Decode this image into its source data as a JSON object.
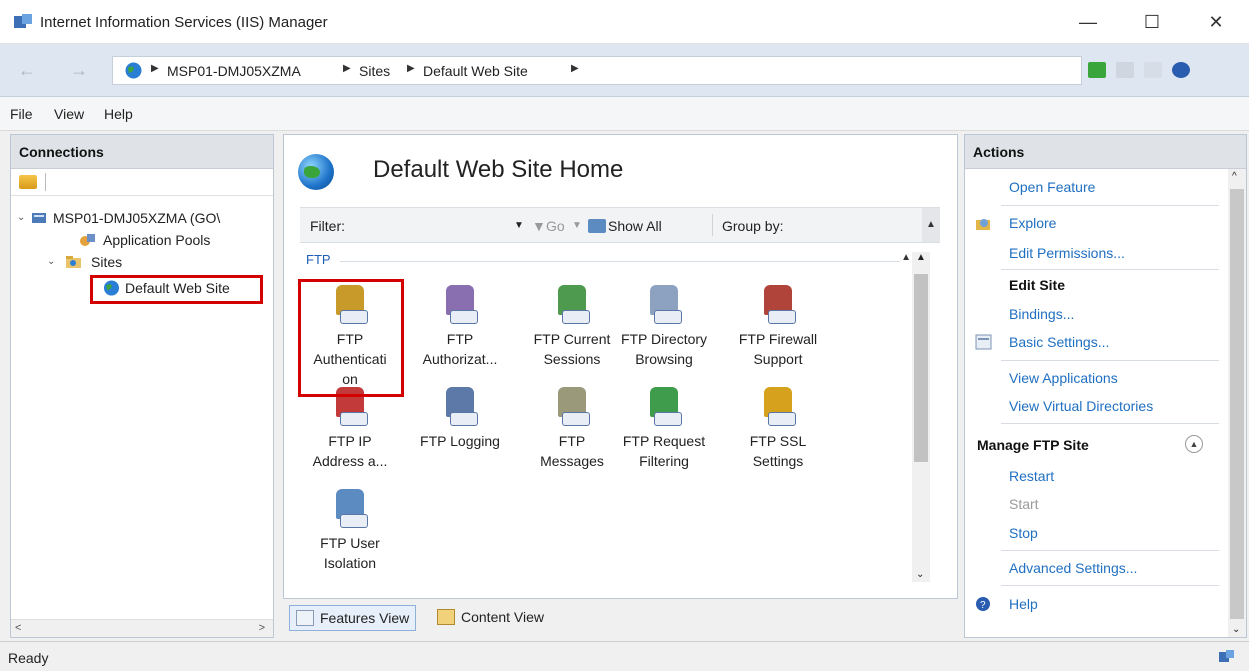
{
  "window": {
    "title": "Internet Information Services (IIS) Manager",
    "minimize": "—",
    "maximize": "☐",
    "close": "✕"
  },
  "address": {
    "back": "←",
    "forward": "→",
    "crumbs": [
      "MSP01-DMJ05XZMA",
      "Sites",
      "Default Web Site"
    ],
    "separator": "▶"
  },
  "menu": [
    "File",
    "View",
    "Help"
  ],
  "connections": {
    "header": "Connections",
    "tree": {
      "server": "MSP01-DMJ05XZMA (GO\\",
      "app_pools": "Application Pools",
      "sites": "Sites",
      "selected_site": "Default Web Site"
    }
  },
  "center": {
    "title": "Default Web Site Home",
    "filter_label": "Filter:",
    "go": "Go",
    "show_all": "Show All",
    "group_by": "Group by:",
    "group_name": "FTP",
    "features": [
      {
        "line1": "FTP",
        "line2": "Authenticati",
        "line3": "on",
        "icon": "ftp-authentication-icon",
        "color": "#c79a2a"
      },
      {
        "line1": "FTP",
        "line2": "Authorizat...",
        "line3": "",
        "icon": "ftp-authorization-icon",
        "color": "#8a6fb0"
      },
      {
        "line1": "FTP Current",
        "line2": "Sessions",
        "line3": "",
        "icon": "ftp-current-sessions-icon",
        "color": "#4e9a4e"
      },
      {
        "line1": "FTP Directory",
        "line2": "Browsing",
        "line3": "",
        "icon": "ftp-directory-browsing-icon",
        "color": "#8da2c0"
      },
      {
        "line1": "FTP Firewall",
        "line2": "Support",
        "line3": "",
        "icon": "ftp-firewall-icon",
        "color": "#b0443a"
      },
      {
        "line1": "FTP IP",
        "line2": "Address a...",
        "line3": "",
        "icon": "ftp-ip-address-icon",
        "color": "#c23a3a"
      },
      {
        "line1": "FTP Logging",
        "line2": "",
        "line3": "",
        "icon": "ftp-logging-icon",
        "color": "#5d79a8"
      },
      {
        "line1": "FTP",
        "line2": "Messages",
        "line3": "",
        "icon": "ftp-messages-icon",
        "color": "#9a9a7a"
      },
      {
        "line1": "FTP Request",
        "line2": "Filtering",
        "line3": "",
        "icon": "ftp-request-filtering-icon",
        "color": "#3e9c4c"
      },
      {
        "line1": "FTP SSL",
        "line2": "Settings",
        "line3": "",
        "icon": "ftp-ssl-icon",
        "color": "#d6a21e"
      },
      {
        "line1": "FTP User",
        "line2": "Isolation",
        "line3": "",
        "icon": "ftp-user-isolation-icon",
        "color": "#5b8bc0"
      }
    ],
    "tabs": {
      "features_view": "Features View",
      "content_view": "Content View"
    }
  },
  "actions": {
    "header": "Actions",
    "open_feature": "Open Feature",
    "explore": "Explore",
    "edit_permissions": "Edit Permissions...",
    "edit_site": "Edit Site",
    "bindings": "Bindings...",
    "basic_settings": "Basic Settings...",
    "view_applications": "View Applications",
    "view_virtual_directories": "View Virtual Directories",
    "manage_ftp_site": "Manage FTP Site",
    "restart": "Restart",
    "start": "Start",
    "stop": "Stop",
    "advanced_settings": "Advanced Settings...",
    "help": "Help"
  },
  "status": {
    "text": "Ready"
  },
  "colors": {
    "highlight": "#d40000",
    "link": "#1f6fc2",
    "group": "#1a5fb4"
  }
}
